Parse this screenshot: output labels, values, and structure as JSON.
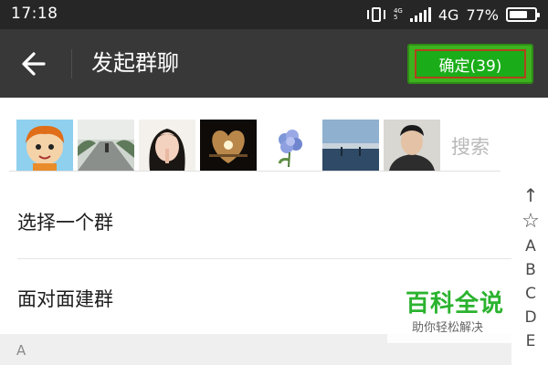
{
  "status_bar": {
    "time": "17:18",
    "net_small_top": "4G",
    "net_small_bottom": "5",
    "net_label": "4G",
    "battery_percent": "77%",
    "battery_level": 0.77,
    "icons": [
      "vibrate-icon",
      "signal-icon",
      "battery-icon"
    ]
  },
  "app_bar": {
    "back_icon": "arrow-left-icon",
    "title": "发起群聊",
    "confirm_label": "确定(39)"
  },
  "avatar_strip": {
    "avatars": [
      {
        "name": "avatar-cartoon-boy"
      },
      {
        "name": "avatar-road-scene"
      },
      {
        "name": "avatar-girl-portrait"
      },
      {
        "name": "avatar-heart-moon"
      },
      {
        "name": "avatar-hydrangea-flower"
      },
      {
        "name": "avatar-sunset-beach"
      },
      {
        "name": "avatar-man-portrait"
      }
    ],
    "search_placeholder": "搜索"
  },
  "list": {
    "items": [
      {
        "label": "选择一个群"
      },
      {
        "label": "面对面建群"
      }
    ],
    "section_header": "A"
  },
  "index_bar": {
    "icons": [
      "arrow-up-icon",
      "star-icon"
    ],
    "letters": [
      "A",
      "B",
      "C",
      "D",
      "E"
    ]
  },
  "watermark": {
    "title": "百科全说",
    "subtitle": "助你轻松解决"
  },
  "colors": {
    "status_bar_bg": "#262626",
    "app_bar_bg": "#383838",
    "confirm_green": "#1aad19",
    "watermark_green": "#2bb32f",
    "section_header_bg": "#efefef"
  }
}
